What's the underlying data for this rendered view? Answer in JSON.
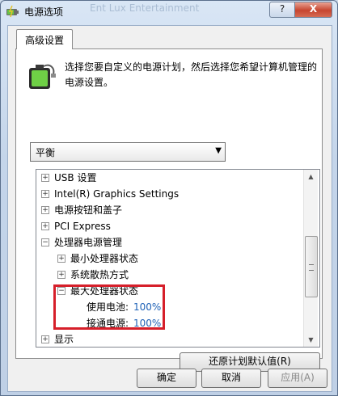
{
  "window": {
    "title": "电源选项",
    "ghost_text": "Ent Lux Entertainment",
    "help_label": "?",
    "close_label": "X"
  },
  "tab": {
    "label": "高级设置"
  },
  "description": "选择您要自定义的电源计划，然后选择您希望计算机管理的电源设置。",
  "plan_select": {
    "value": "平衡"
  },
  "tree": {
    "items": [
      {
        "symbol": "+",
        "label": "USB 设置"
      },
      {
        "symbol": "+",
        "label": "Intel(R) Graphics Settings"
      },
      {
        "symbol": "+",
        "label": "电源按钮和盖子"
      },
      {
        "symbol": "+",
        "label": "PCI Express"
      },
      {
        "symbol": "−",
        "label": "处理器电源管理"
      },
      {
        "symbol": "+",
        "label": "最小处理器状态"
      },
      {
        "symbol": "+",
        "label": "系统散热方式"
      },
      {
        "symbol": "−",
        "label": "最大处理器状态"
      },
      {
        "label": "使用电池:",
        "value": "100%"
      },
      {
        "label": "接通电源:",
        "value": "100%"
      },
      {
        "symbol": "+",
        "label": "显示"
      }
    ]
  },
  "buttons": {
    "restore": "还原计划默认值(R)",
    "ok": "确定",
    "cancel": "取消",
    "apply": "应用(A)"
  },
  "colors": {
    "highlight_border": "#d61f2a",
    "value_link": "#1f62b7"
  }
}
